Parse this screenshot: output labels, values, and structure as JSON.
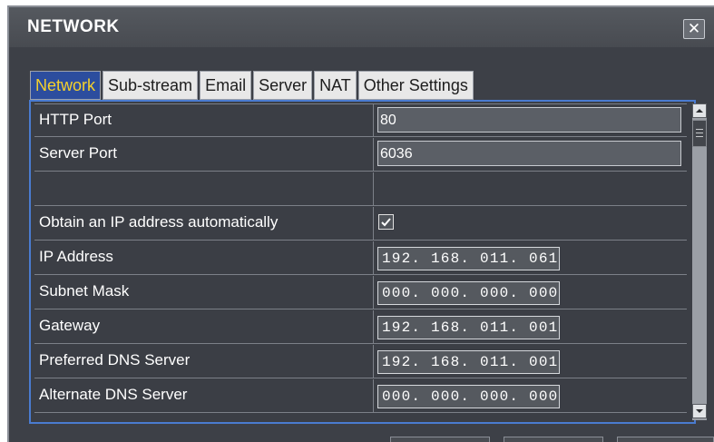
{
  "window": {
    "title": "NETWORK",
    "close_label": "✕"
  },
  "tabs": [
    {
      "label": "Network",
      "active": true
    },
    {
      "label": "Sub-stream",
      "active": false
    },
    {
      "label": "Email",
      "active": false
    },
    {
      "label": "Server",
      "active": false
    },
    {
      "label": "NAT",
      "active": false
    },
    {
      "label": "Other Settings",
      "active": false
    }
  ],
  "network": {
    "http_port": {
      "label": "HTTP Port",
      "value": "80"
    },
    "server_port": {
      "label": "Server Port",
      "value": "6036"
    },
    "obtain_ip": {
      "label": "Obtain an IP address automatically",
      "checked": true
    },
    "ip_address": {
      "label": "IP Address",
      "value": "192. 168. 011. 061"
    },
    "subnet_mask": {
      "label": "Subnet Mask",
      "value": "000. 000. 000. 000"
    },
    "gateway": {
      "label": "Gateway",
      "value": "192. 168. 011. 001"
    },
    "preferred_dns": {
      "label": "Preferred DNS Server",
      "value": "192. 168. 011. 001"
    },
    "alternate_dns": {
      "label": "Alternate DNS Server",
      "value": "000. 000. 000. 000"
    }
  },
  "colors": {
    "active_tab_bg": "#2c4d9e",
    "active_tab_text": "#f6d12b",
    "panel_border": "#4a7bd0"
  },
  "icons": {
    "close": "close-icon",
    "checkbox": "checkmark-icon",
    "scroll_up": "scroll-up-arrow-icon",
    "scroll_down": "scroll-down-arrow-icon"
  }
}
